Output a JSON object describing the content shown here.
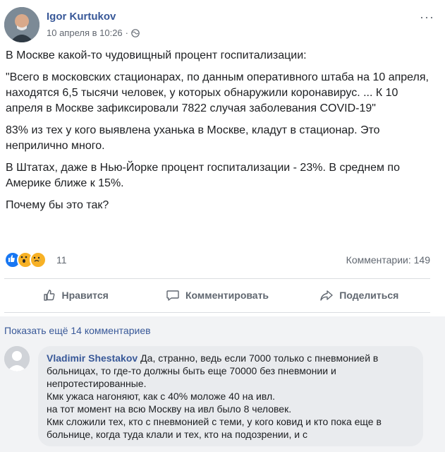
{
  "post": {
    "author": "Igor Kurtukov",
    "date": "10 апреля в 10:26",
    "more_label": "···",
    "paragraphs": [
      "В Москве какой-то чудовищный процент госпитализации:",
      "\"Всего в московских стационарах, по данным оперативного штаба на 10 апреля, находятся 6,5 тысячи человек, у которых обнаружили коронавирус. ... К 10 апреля в Москве зафиксировали 7822 случая заболевания COVID-19\"",
      "83% из тех у кого выявлена уханька в Москве, кладут в стационар. Это неприлично много.",
      "В Штатах, даже в Нью-Йорке процент госпитализации - 23%. В среднем по Америке ближе к 15%.",
      "Почему бы это так?"
    ]
  },
  "reactions": {
    "count": "11",
    "comments_count": "Комментарии: 149",
    "icons": [
      "like-icon",
      "wow-icon",
      "sad-icon"
    ]
  },
  "actions": {
    "like": "Нравится",
    "comment": "Комментировать",
    "share": "Поделиться"
  },
  "comments": {
    "show_more": "Показать ещё 14 комментариев",
    "first": {
      "author": "Vladimir Shestakov",
      "text": "Да, странно, ведь если 7000 только с пневмонией в больницах, то где-то должны быть еще 70000 без пневмонии и непротестированные.\nКмк ужаса нагоняют, как с 40% моложе 40 на ивл.\nна тот момент на всю Москву на ивл было 8 человек.\nКмк сложили тех, кто с пневмонией с теми, у кого ковид и кто пока еще в больнице, когда туда клали и тех, кто на подозрении, и с"
    }
  },
  "colors": {
    "link": "#385898",
    "text": "#1c1e21",
    "muted": "#606770",
    "like_blue": "#1877f2",
    "emoji_yellow": "#f7b125"
  }
}
